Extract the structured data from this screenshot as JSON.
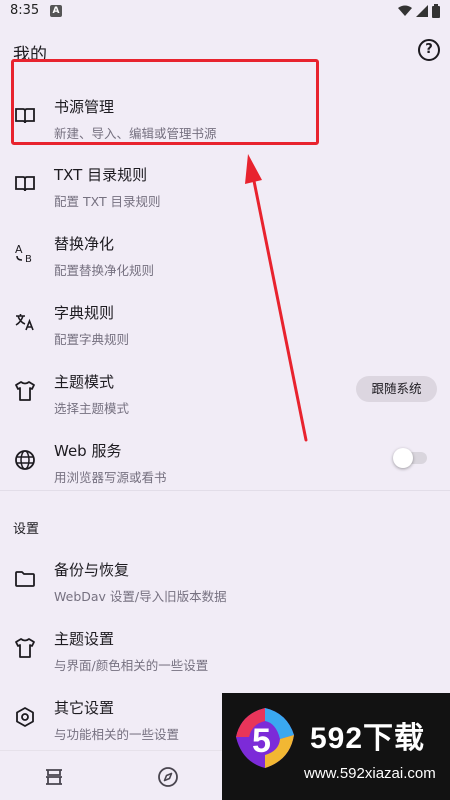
{
  "status_bar": {
    "time": "8:35",
    "notif_letter": "A"
  },
  "header": {
    "title": "我的",
    "help_symbol": "?"
  },
  "items": [
    {
      "title": "书源管理",
      "subtitle": "新建、导入、编辑或管理书源",
      "icon": "book-icon"
    },
    {
      "title": "TXT 目录规则",
      "subtitle": "配置 TXT 目录规则",
      "icon": "book-icon"
    },
    {
      "title": "替换净化",
      "subtitle": "配置替换净化规则",
      "icon": "replace-icon"
    },
    {
      "title": "字典规则",
      "subtitle": "配置字典规则",
      "icon": "translate-icon"
    },
    {
      "title": "主题模式",
      "subtitle": "选择主题模式",
      "icon": "shirt-icon",
      "chip": "跟随系统"
    },
    {
      "title": "Web 服务",
      "subtitle": "用浏览器写源或看书",
      "icon": "globe-icon",
      "toggle": false
    }
  ],
  "settings_section": {
    "label": "设置",
    "items": [
      {
        "title": "备份与恢复",
        "subtitle": "WebDav 设置/导入旧版本数据",
        "icon": "folder-icon"
      },
      {
        "title": "主题设置",
        "subtitle": "与界面/颜色相关的一些设置",
        "icon": "shirt-icon"
      },
      {
        "title": "其它设置",
        "subtitle": "与功能相关的一些设置",
        "icon": "hexagon-icon"
      }
    ]
  },
  "watermark": {
    "number": "5",
    "title": "592下载",
    "url": "www.592xiazai.com"
  },
  "colors": {
    "accent": "#e8232e",
    "background": "#f1ecf6",
    "chip": "#dcd6e0"
  }
}
